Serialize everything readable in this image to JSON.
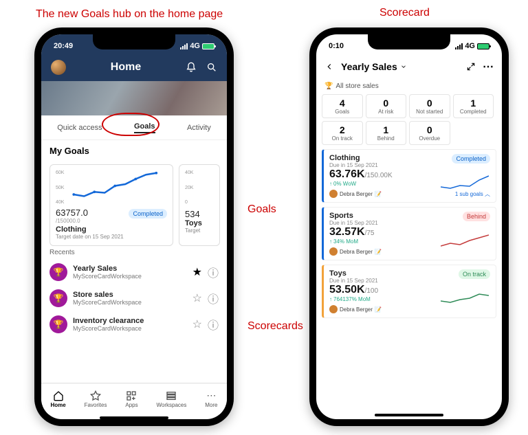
{
  "annotations": {
    "top_left": "The new Goals hub on the home page",
    "top_right": "Scorecard",
    "goals_label": "Goals",
    "scorecards_label": "Scorecards"
  },
  "left_phone": {
    "status": {
      "time": "20:49",
      "net": "4G"
    },
    "header": {
      "title": "Home"
    },
    "tabs": [
      "Quick access",
      "Goals",
      "Activity"
    ],
    "active_tab_index": 1,
    "my_goals_title": "My Goals",
    "goal_cards": [
      {
        "y_ticks": [
          "60K",
          "50K",
          "40K"
        ],
        "value": "63757.0",
        "target": "/150000.0",
        "status": "Completed",
        "status_class": "completed",
        "name": "Clothing",
        "sub": "Target date on 15 Sep 2021"
      },
      {
        "y_ticks": [
          "40K",
          "20K",
          "0"
        ],
        "value": "534",
        "name": "Toys",
        "sub": "Target"
      }
    ],
    "recents_label": "Recents",
    "scorecards": [
      {
        "name": "Yearly Sales",
        "workspace": "MyScoreCardWorkspace",
        "starred": true
      },
      {
        "name": "Store sales",
        "workspace": "MyScoreCardWorkspace",
        "starred": false
      },
      {
        "name": "Inventory clearance",
        "workspace": "MyScoreCardWorkspace",
        "starred": false
      }
    ],
    "tabbar": [
      "Home",
      "Favorites",
      "Apps",
      "Workspaces",
      "More"
    ]
  },
  "right_phone": {
    "status": {
      "time": "0:10",
      "net": "4G"
    },
    "title": "Yearly Sales",
    "breadcrumb": "All store sales",
    "summary": [
      {
        "n": "4",
        "l": "Goals"
      },
      {
        "n": "0",
        "l": "At risk"
      },
      {
        "n": "0",
        "l": "Not started"
      },
      {
        "n": "1",
        "l": "Completed"
      },
      {
        "n": "2",
        "l": "On track"
      },
      {
        "n": "1",
        "l": "Behind"
      },
      {
        "n": "0",
        "l": "Overdue"
      }
    ],
    "goals": [
      {
        "name": "Clothing",
        "due": "Due in 15 Sep 2021",
        "value": "63.76K",
        "target": "/150.00K",
        "delta": "0% WoW",
        "status": "Completed",
        "status_class": "completed",
        "owner": "Debra Berger",
        "sub_goals": "1 sub goals",
        "accent": "#1368d8",
        "spark_color": "#1368d8"
      },
      {
        "name": "Sports",
        "due": "Due in 15 Sep 2021",
        "value": "32.57K",
        "target": "/75",
        "delta": "34% MoM",
        "status": "Behind",
        "status_class": "behind",
        "owner": "Debra Berger",
        "accent": "#1368d8",
        "spark_color": "#c43a3a"
      },
      {
        "name": "Toys",
        "due": "Due in 15 Sep 2021",
        "value": "53.50K",
        "target": "/100",
        "delta": "764137% MoM",
        "status": "On track",
        "status_class": "ontrack",
        "owner": "Debra Berger",
        "accent": "#f2a23a",
        "spark_color": "#2e8b57"
      }
    ]
  }
}
